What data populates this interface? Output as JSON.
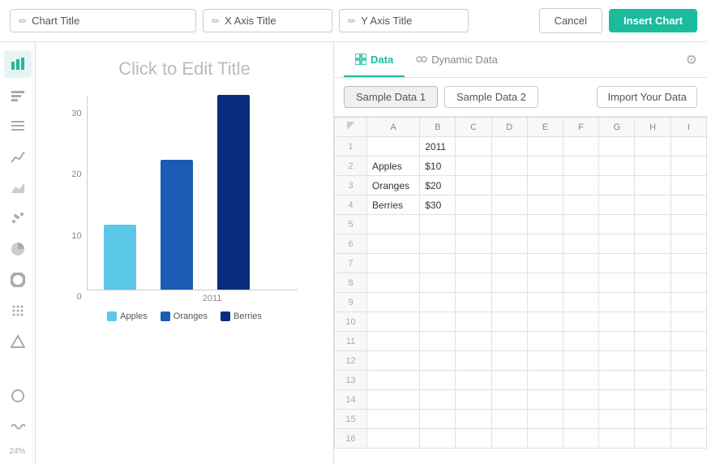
{
  "topbar": {
    "chart_title_placeholder": "Chart Title",
    "x_axis_placeholder": "X Axis Title",
    "y_axis_placeholder": "Y Axis Title",
    "cancel_label": "Cancel",
    "insert_label": "Insert Chart"
  },
  "sidebar": {
    "icons": [
      {
        "name": "bar-chart-icon",
        "symbol": "▋",
        "active": true
      },
      {
        "name": "column-chart-icon",
        "symbol": "▐",
        "active": false
      },
      {
        "name": "list-chart-icon",
        "symbol": "≡",
        "active": false
      },
      {
        "name": "line-chart-icon",
        "symbol": "∕",
        "active": false
      },
      {
        "name": "area-chart-icon",
        "symbol": "◿",
        "active": false
      },
      {
        "name": "scatter-icon",
        "symbol": "⁚",
        "active": false
      },
      {
        "name": "pie-icon",
        "symbol": "◑",
        "active": false
      },
      {
        "name": "donut-icon",
        "symbol": "○",
        "active": false
      },
      {
        "name": "dot-grid-icon",
        "symbol": "⠿",
        "active": false
      },
      {
        "name": "triangle-icon",
        "symbol": "△",
        "active": false
      },
      {
        "name": "circle-icon",
        "symbol": "◎",
        "active": false
      },
      {
        "name": "wave-icon",
        "symbol": "≈",
        "active": false
      }
    ],
    "percent": "24%"
  },
  "chart": {
    "title": "Click to Edit Title",
    "y_labels": [
      "30",
      "20",
      "10",
      "0"
    ],
    "bars": [
      {
        "label": "Apples",
        "color": "#5bc8e8",
        "height_pct": 33
      },
      {
        "label": "Oranges",
        "color": "#1a5cb5",
        "height_pct": 66
      },
      {
        "label": "Berries",
        "color": "#0a2d80",
        "height_pct": 100
      }
    ],
    "x_label": "2011",
    "legend": [
      {
        "label": "Apples",
        "color": "#5bc8e8"
      },
      {
        "label": "Oranges",
        "color": "#1a5cb5"
      },
      {
        "label": "Berries",
        "color": "#0a2d80"
      }
    ]
  },
  "panel": {
    "tabs": [
      {
        "label": "Data",
        "icon": "grid-icon",
        "active": true
      },
      {
        "label": "Dynamic Data",
        "icon": "link-icon",
        "active": false
      }
    ],
    "data_buttons": [
      {
        "label": "Sample Data 1",
        "active": true
      },
      {
        "label": "Sample Data 2",
        "active": false
      }
    ],
    "import_label": "Import Your Data",
    "columns": [
      "",
      "A",
      "B",
      "C",
      "D",
      "E",
      "F",
      "G",
      "H",
      "I"
    ],
    "rows": [
      {
        "row": 1,
        "A": "",
        "B": "2011",
        "C": "",
        "D": "",
        "E": "",
        "F": "",
        "G": "",
        "H": "",
        "I": ""
      },
      {
        "row": 2,
        "A": "Apples",
        "B": "$10",
        "C": "",
        "D": "",
        "E": "",
        "F": "",
        "G": "",
        "H": "",
        "I": ""
      },
      {
        "row": 3,
        "A": "Oranges",
        "B": "$20",
        "C": "",
        "D": "",
        "E": "",
        "F": "",
        "G": "",
        "H": "",
        "I": ""
      },
      {
        "row": 4,
        "A": "Berries",
        "B": "$30",
        "C": "",
        "D": "",
        "E": "",
        "F": "",
        "G": "",
        "H": "",
        "I": ""
      },
      {
        "row": 5,
        "A": "",
        "B": "",
        "C": "",
        "D": "",
        "E": "",
        "F": "",
        "G": "",
        "H": "",
        "I": ""
      },
      {
        "row": 6,
        "A": "",
        "B": "",
        "C": "",
        "D": "",
        "E": "",
        "F": "",
        "G": "",
        "H": "",
        "I": ""
      },
      {
        "row": 7,
        "A": "",
        "B": "",
        "C": "",
        "D": "",
        "E": "",
        "F": "",
        "G": "",
        "H": "",
        "I": ""
      },
      {
        "row": 8,
        "A": "",
        "B": "",
        "C": "",
        "D": "",
        "E": "",
        "F": "",
        "G": "",
        "H": "",
        "I": ""
      },
      {
        "row": 9,
        "A": "",
        "B": "",
        "C": "",
        "D": "",
        "E": "",
        "F": "",
        "G": "",
        "H": "",
        "I": ""
      },
      {
        "row": 10,
        "A": "",
        "B": "",
        "C": "",
        "D": "",
        "E": "",
        "F": "",
        "G": "",
        "H": "",
        "I": ""
      },
      {
        "row": 11,
        "A": "",
        "B": "",
        "C": "",
        "D": "",
        "E": "",
        "F": "",
        "G": "",
        "H": "",
        "I": ""
      },
      {
        "row": 12,
        "A": "",
        "B": "",
        "C": "",
        "D": "",
        "E": "",
        "F": "",
        "G": "",
        "H": "",
        "I": ""
      },
      {
        "row": 13,
        "A": "",
        "B": "",
        "C": "",
        "D": "",
        "E": "",
        "F": "",
        "G": "",
        "H": "",
        "I": ""
      },
      {
        "row": 14,
        "A": "",
        "B": "",
        "C": "",
        "D": "",
        "E": "",
        "F": "",
        "G": "",
        "H": "",
        "I": ""
      },
      {
        "row": 15,
        "A": "",
        "B": "",
        "C": "",
        "D": "",
        "E": "",
        "F": "",
        "G": "",
        "H": "",
        "I": ""
      },
      {
        "row": 16,
        "A": "",
        "B": "",
        "C": "",
        "D": "",
        "E": "",
        "F": "",
        "G": "",
        "H": "",
        "I": ""
      }
    ]
  }
}
